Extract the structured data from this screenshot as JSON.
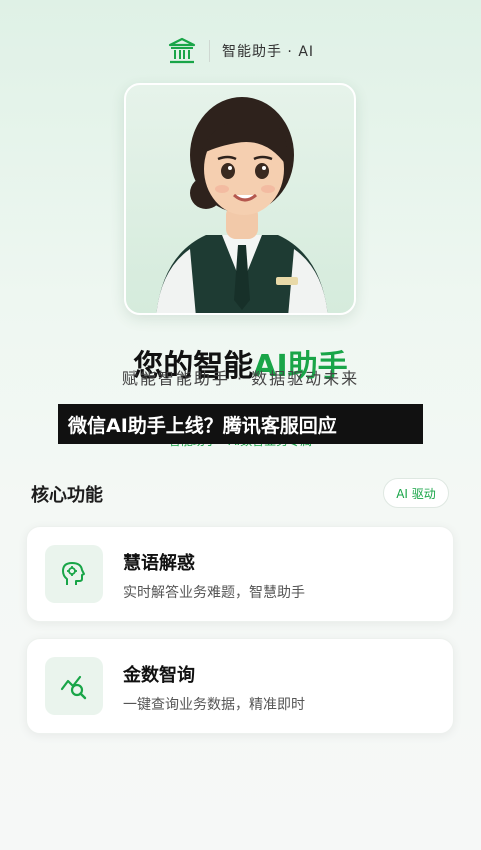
{
  "header": {
    "title": "智能助手 · AI",
    "logo_icon": "bank-building-icon"
  },
  "hero": {
    "avatar": "assistant-avatar",
    "title_prefix": "您的智能",
    "title_accent": "AI助手",
    "subtitle": "赋能智能助手 · 数据驱动未来",
    "tagline": "智能助手 · AI数智业务专属"
  },
  "banner": {
    "text": "微信AI助手上线？腾讯客服回应"
  },
  "section": {
    "title": "核心功能",
    "badge": "AI 驱动"
  },
  "features": [
    {
      "title": "慧语解惑",
      "description": "实时解答业务难题，智慧助手",
      "icon": "head-gear-icon"
    },
    {
      "title": "金数智询",
      "description": "一键查询业务数据，精准即时",
      "icon": "chart-search-icon"
    }
  ],
  "colors": {
    "accent": "#19a548",
    "background": "#eef7f1",
    "banner_bg": "#111111"
  }
}
